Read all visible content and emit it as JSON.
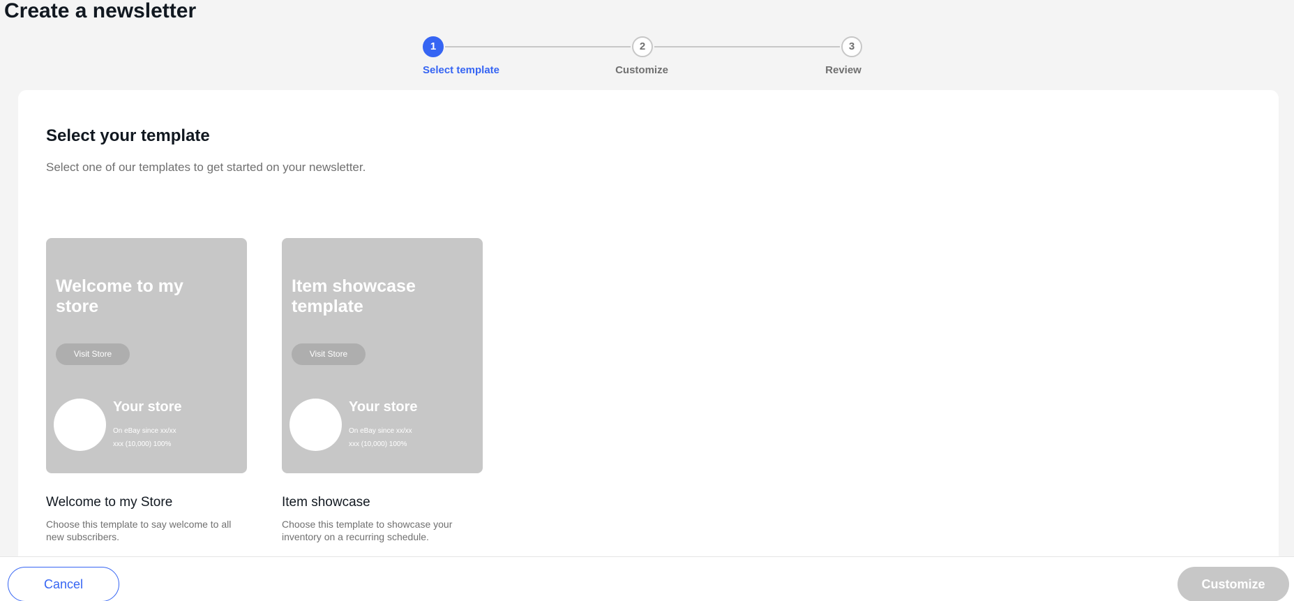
{
  "page": {
    "title": "Create a newsletter"
  },
  "stepper": {
    "steps": [
      {
        "number": "1",
        "label": "Select template",
        "state": "active"
      },
      {
        "number": "2",
        "label": "Customize",
        "state": "inactive"
      },
      {
        "number": "3",
        "label": "Review",
        "state": "inactive"
      }
    ]
  },
  "content": {
    "title": "Select your template",
    "subtitle": "Select one of our templates to get started on your newsletter."
  },
  "templates": [
    {
      "preview_title": "Welcome to my store",
      "visit_label": "Visit Store",
      "store_name": "Your store",
      "store_since": "On eBay since xx/xx",
      "store_rating": "xxx (10,000) 100%",
      "name": "Welcome to my Store",
      "description": "Choose this template to say welcome to all new subscribers."
    },
    {
      "preview_title": "Item showcase template",
      "visit_label": "Visit Store",
      "store_name": "Your store",
      "store_since": "On eBay since xx/xx",
      "store_rating": "xxx (10,000) 100%",
      "name": "Item showcase",
      "description": "Choose this template to showcase your inventory on a recurring schedule."
    }
  ],
  "footer": {
    "cancel_label": "Cancel",
    "customize_label": "Customize"
  },
  "colors": {
    "accent": "#3665f3",
    "placeholder_gray": "#c7c7c7",
    "disabled_button": "#c7c7c7"
  }
}
